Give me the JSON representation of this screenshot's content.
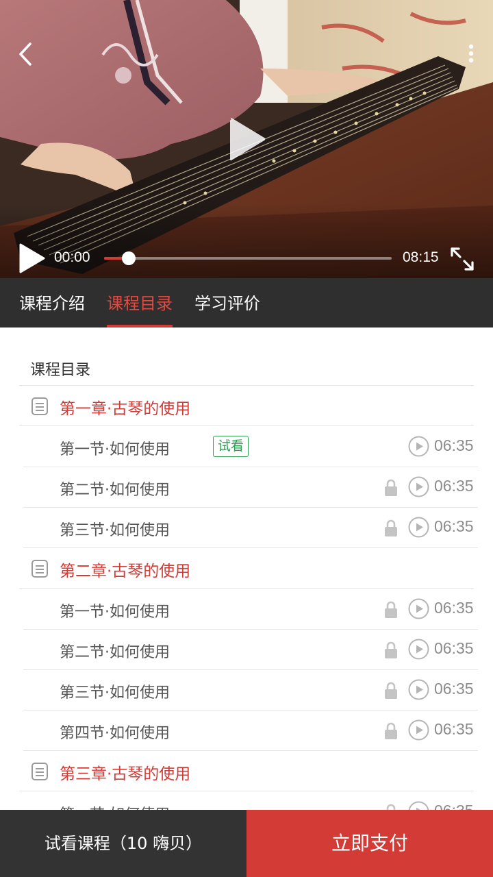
{
  "player": {
    "current_time": "00:00",
    "total_time": "08:15",
    "progress": 0.085,
    "accent_color": "#d23b36"
  },
  "tabs": [
    {
      "label": "课程介绍",
      "active": false
    },
    {
      "label": "课程目录",
      "active": true
    },
    {
      "label": "学习评价",
      "active": false
    }
  ],
  "catalog": {
    "title": "课程目录",
    "chapters": [
      {
        "label": "第一章·古琴的使用",
        "lessons": [
          {
            "label": "第一节·如何使用",
            "badge": "试看",
            "locked": false,
            "duration": "06:35"
          },
          {
            "label": "第二节·如何使用",
            "locked": true,
            "duration": "06:35"
          },
          {
            "label": "第三节·如何使用",
            "locked": true,
            "duration": "06:35"
          }
        ]
      },
      {
        "label": "第二章·古琴的使用",
        "lessons": [
          {
            "label": "第一节·如何使用",
            "locked": true,
            "duration": "06:35"
          },
          {
            "label": "第二节·如何使用",
            "locked": true,
            "duration": "06:35"
          },
          {
            "label": "第三节·如何使用",
            "locked": true,
            "duration": "06:35"
          },
          {
            "label": "第四节·如何使用",
            "locked": true,
            "duration": "06:35"
          }
        ]
      },
      {
        "label": "第三章·古琴的使用",
        "lessons": [
          {
            "label": "第一节·如何使用",
            "locked": true,
            "duration": "06:35"
          }
        ]
      }
    ]
  },
  "bottom_bar": {
    "trial_label": "试看课程（10 嗨贝）",
    "pay_label": "立即支付"
  },
  "icons": [
    "back-arrow-icon",
    "more-vertical-icon",
    "play-icon",
    "fullscreen-icon",
    "chapter-document-icon",
    "lock-icon",
    "play-circle-icon"
  ]
}
